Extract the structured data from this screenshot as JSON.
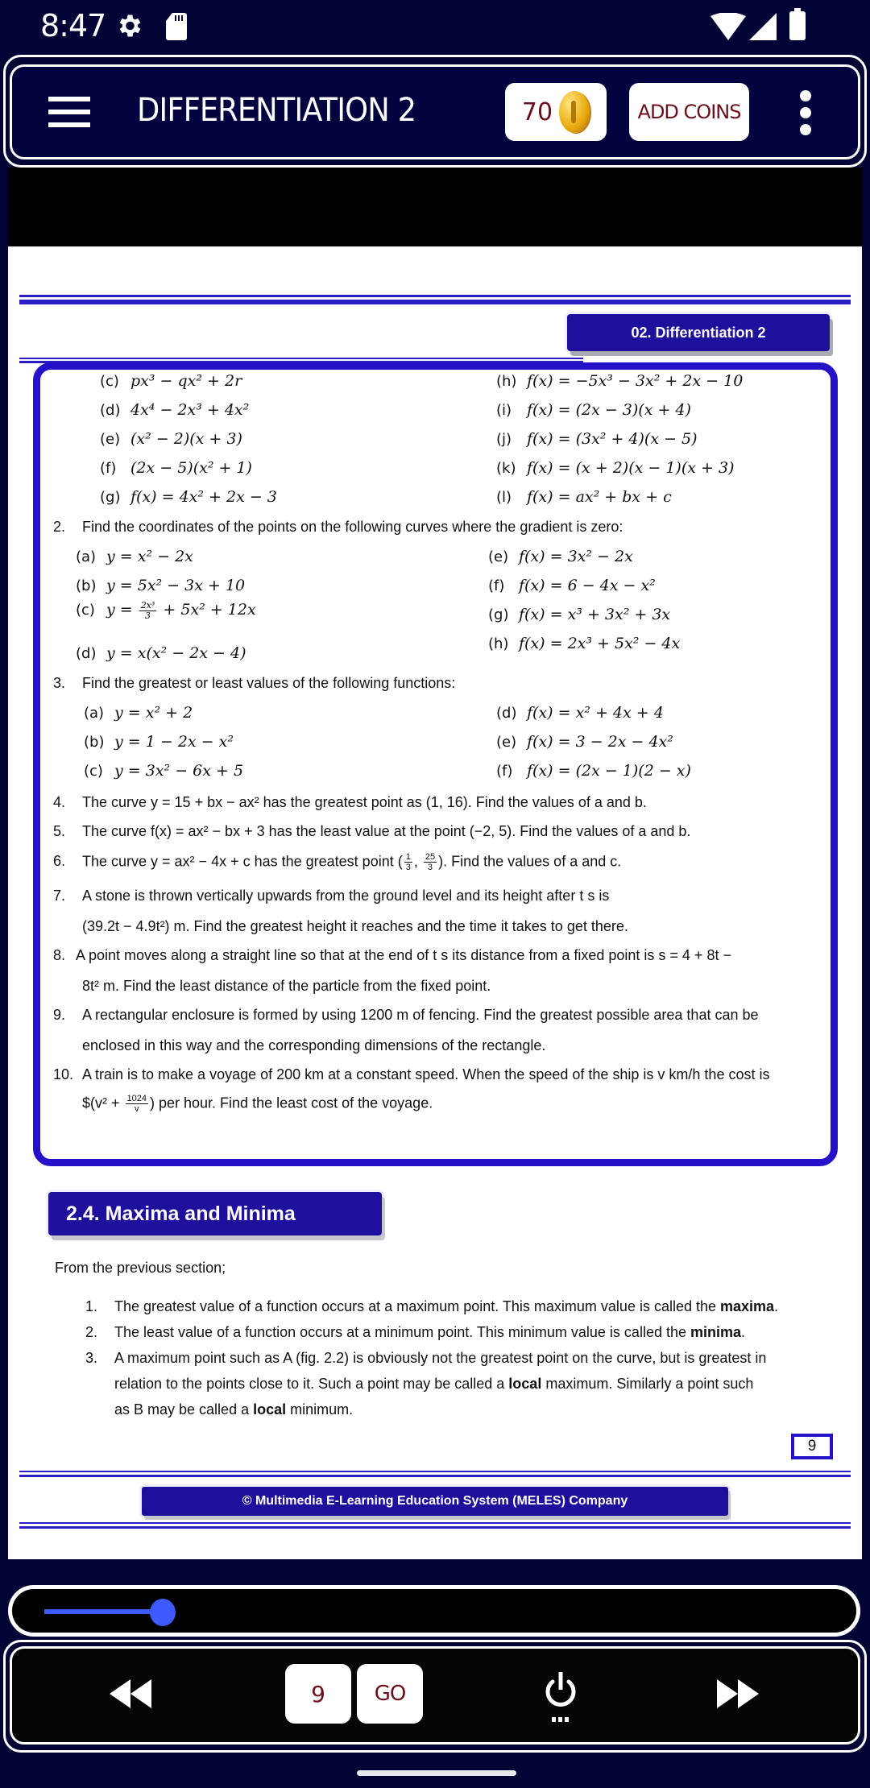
{
  "status_bar": {
    "time": "8:47",
    "icons": [
      "gear-icon",
      "sd-card-icon",
      "wifi-icon",
      "cell-signal-icon",
      "battery-icon"
    ]
  },
  "header": {
    "title": "DIFFERENTIATION 2",
    "coin_count": "70",
    "add_coins_label": "ADD COINS",
    "menu_icon": "hamburger-icon",
    "more_icon": "kebab-menu-icon"
  },
  "page": {
    "chapter_tab": "02. Differentiation 2",
    "exercise": {
      "q1_parts_left": [
        {
          "label": "(c)",
          "expr": "px³ − qx² + 2r"
        },
        {
          "label": "(d)",
          "expr": "4x⁴ − 2x³ + 4x²"
        },
        {
          "label": "(e)",
          "expr": "(x² − 2)(x + 3)"
        },
        {
          "label": "(f)",
          "expr": "(2x − 5)(x² + 1)"
        },
        {
          "label": "(g)",
          "expr": "f(x) = 4x² + 2x − 3"
        }
      ],
      "q1_parts_right": [
        {
          "label": "(h)",
          "expr": "f(x) = −5x³ − 3x² + 2x − 10"
        },
        {
          "label": "(i)",
          "expr": "f(x) = (2x − 3)(x + 4)"
        },
        {
          "label": "(j)",
          "expr": "f(x) = (3x² + 4)(x − 5)"
        },
        {
          "label": "(k)",
          "expr": "f(x) = (x + 2)(x − 1)(x + 3)"
        },
        {
          "label": "(l)",
          "expr": "f(x) = ax² + bx + c"
        }
      ],
      "q2": {
        "num": "2.",
        "text": "Find the coordinates of the points on the following curves where the gradient is zero:",
        "left": [
          {
            "label": "(a)",
            "expr": "y = x² − 2x"
          },
          {
            "label": "(b)",
            "expr": "y = 5x² − 3x + 10"
          },
          {
            "label": "(c)",
            "expr_pre": "y = ",
            "frac_num": "2x³",
            "frac_den": "3",
            "expr_post": " + 5x² + 12x"
          },
          {
            "label": "(d)",
            "expr": "y = x(x² − 2x − 4)"
          }
        ],
        "right": [
          {
            "label": "(e)",
            "expr": "f(x) = 3x² − 2x"
          },
          {
            "label": "(f)",
            "expr": "f(x) = 6 − 4x − x²"
          },
          {
            "label": "(g)",
            "expr": "f(x) = x³ + 3x² + 3x"
          },
          {
            "label": "(h)",
            "expr": "f(x) = 2x³ + 5x² − 4x"
          }
        ]
      },
      "q3": {
        "num": "3.",
        "text": "Find the greatest or least values of the following functions:",
        "left": [
          {
            "label": "(a)",
            "expr": "y = x² + 2"
          },
          {
            "label": "(b)",
            "expr": "y = 1 − 2x − x²"
          },
          {
            "label": "(c)",
            "expr": "y = 3x² − 6x + 5"
          }
        ],
        "right": [
          {
            "label": "(d)",
            "expr": "f(x) = x² + 4x + 4"
          },
          {
            "label": "(e)",
            "expr": "f(x) = 3 − 2x − 4x²"
          },
          {
            "label": "(f)",
            "expr": "f(x) = (2x − 1)(2 − x)"
          }
        ]
      },
      "q4": {
        "num": "4.",
        "text": "The curve y = 15 + bx − ax² has the greatest point as (1, 16). Find the values of a and b."
      },
      "q5": {
        "num": "5.",
        "text": "The curve f(x) = ax² − bx + 3 has the least value at the point (−2, 5). Find the values of a and b."
      },
      "q6": {
        "num": "6.",
        "text_pre": "The curve y = ax² − 4x + c has the greatest point (",
        "frac1_num": "1",
        "frac1_den": "3",
        "frac2_num": "25",
        "frac2_den": "3",
        "text_post": "). Find the values of a and c."
      },
      "q7": {
        "num": "7.",
        "line1": "A stone is thrown vertically upwards from the ground level and its height after t s is",
        "line2": "(39.2t − 4.9t²) m. Find the greatest height it reaches and the time it takes to get there."
      },
      "q8": {
        "num": "8.",
        "line1": "A point moves along a straight line so that at the end of t s its distance from a fixed point is s = 4 + 8t −",
        "line2": "8t² m. Find the least distance of the particle from the fixed point."
      },
      "q9": {
        "num": "9.",
        "line1": "A rectangular enclosure is formed by using 1200 m of fencing. Find the greatest possible area that can be",
        "line2": "enclosed in this way and the corresponding dimensions of the rectangle."
      },
      "q10": {
        "num": "10.",
        "line1": "A train is to make a voyage of 200 km at a constant speed. When the speed of the ship is v km/h the cost is",
        "line2_pre": "$(v² + ",
        "frac_num": "1024",
        "frac_den": "v",
        "line2_post": ") per hour. Find the least cost of the voyage."
      }
    },
    "section_title": "2.4. Maxima and Minima",
    "intro": "From the previous section;",
    "points": [
      {
        "num": "1.",
        "text": "The greatest value of a function occurs at a maximum point.  This maximum value is called the ",
        "bold": "maxima",
        "end": "."
      },
      {
        "num": "2.",
        "text": "The least value of a function occurs at a minimum point. This minimum value is called the ",
        "bold": "minima",
        "end": "."
      },
      {
        "num": "3.",
        "line1": "A maximum point such as A (fig. 2.2) is obviously not the greatest point on the curve, but is greatest in",
        "line2_pre": "relation to the points close to it. Such a point may be called a ",
        "line2_bold": "local",
        "line2_post": " maximum. Similarly a point such",
        "line3_pre": "as B may be called a ",
        "line3_bold": "local",
        "line3_post": " minimum."
      }
    ],
    "page_number": "9",
    "footer": "© Multimedia E-Learning Education System (MELES) Company"
  },
  "controls": {
    "slider_progress": 0.15,
    "page_input_value": "9",
    "go_label": "GO",
    "icons": [
      "rewind-icon",
      "power-icon",
      "fast-forward-icon"
    ]
  },
  "colors": {
    "frame_navy": "#020335",
    "accent_blue": "#2511c8",
    "tab_blue": "#1e0f9c",
    "button_text": "#6b0f1a",
    "slider_blue": "#3d5afe"
  }
}
